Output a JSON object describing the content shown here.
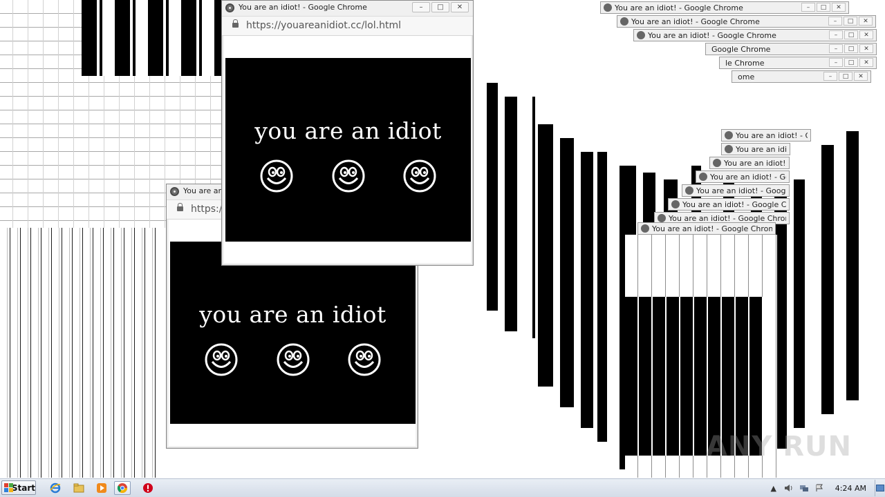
{
  "popup": {
    "title": "You are an idiot! - Google Chrome",
    "title_short": "You are an",
    "url": "https://youareanidiot.cc/lol.html",
    "url_short": "https:/",
    "headline": "you are an idiot",
    "minimize": "–",
    "maximize": "□",
    "close": "✕"
  },
  "mini_titles": [
    "You are an idiot! - Google Chrome",
    "You are an idiot! - Google Chrome",
    "You are an idiot! - Google Chrome",
    "You are an idiot! - Google Chrome",
    "You are an idiot! - Google Chrome",
    "You are an idiot! - Google Chrome",
    "You are an idiot! - Google Chrome",
    "You are an idiot! - Goo",
    "You are an idiot! - Google C",
    "You are an idiot! - Google Chron",
    "You are an idiot! - Google Chrome",
    "You are an idiot! - Google Chrome"
  ],
  "partial_titles": {
    "t1": "Google Chrome",
    "t2": "le Chrome",
    "t3": "ome"
  },
  "taskbar": {
    "start_label": "Start",
    "clock": "4:24 AM"
  },
  "watermark": "ANY RUN",
  "colors": {
    "popup_content_bg": "#000000",
    "popup_text": "#ffffff",
    "taskbar_bg": "#dbe3ee",
    "alert_icon": "#d0021b"
  },
  "icons": [
    "internet-explorer-icon",
    "file-explorer-icon",
    "media-player-icon",
    "chrome-icon",
    "alert-stop-icon"
  ]
}
